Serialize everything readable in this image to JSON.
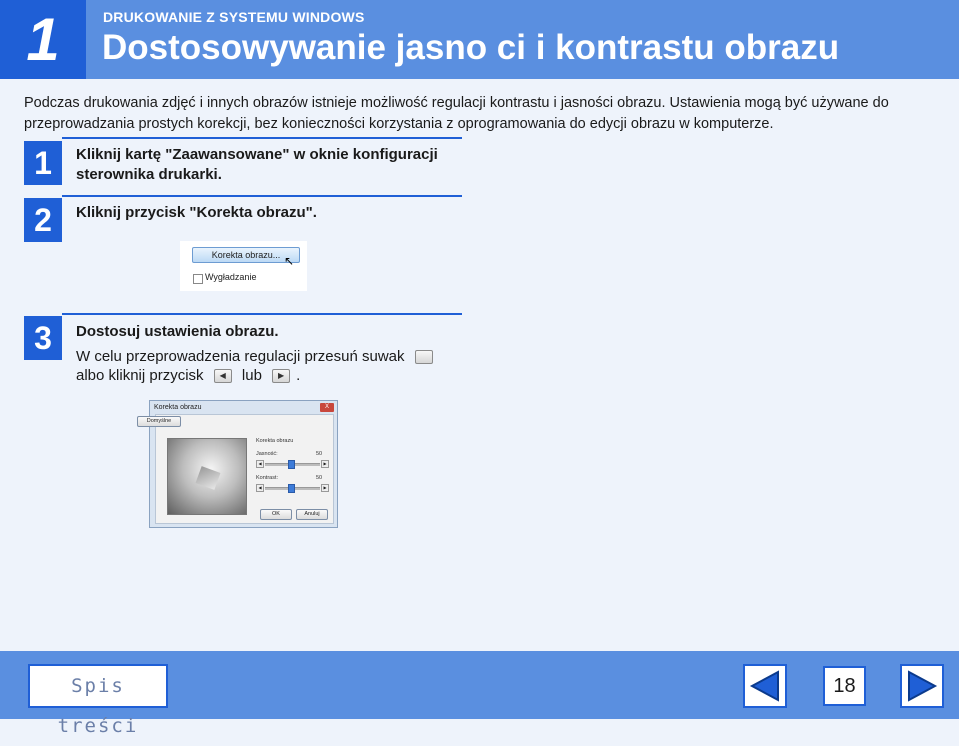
{
  "header": {
    "chapter": "1",
    "section": "DRUKOWANIE Z SYSTEMU WINDOWS",
    "title": "Dostosowywanie jasno ci i kontrastu obrazu"
  },
  "intro": "Podczas drukowania zdjęć i innych obrazów istnieje możliwość regulacji kontrastu i jasności obrazu. Ustawienia mogą być używane do przeprowadzania prostych korekcji, bez konieczności korzystania z oprogramowania do edycji obrazu w komputerze.",
  "steps": [
    {
      "num": "1",
      "text": "Kliknij kartę \"Zaawansowane\" w oknie konfiguracji sterownika drukarki."
    },
    {
      "num": "2",
      "text": "Kliknij przycisk \"Korekta obrazu\"."
    },
    {
      "num": "3",
      "text": "Dostosuj ustawienia obrazu.",
      "body_line1": "W celu przeprowadzenia regulacji przesuń suwak",
      "body_line2a": "albo kliknij przycisk",
      "body_line2b": "lub",
      "body_line2c": "."
    }
  ],
  "screenshot1": {
    "button": "Korekta obrazu...",
    "checkbox": "Wygładzanie"
  },
  "dialog": {
    "title": "Korekta obrazu",
    "default_btn": "Domyślne",
    "group": "Korekta obrazu",
    "brightness_label": "Jasność:",
    "brightness_value": "50",
    "contrast_label": "Kontrast:",
    "contrast_value": "50",
    "ok": "OK",
    "cancel": "Anuluj"
  },
  "footer": {
    "toc": "Spis treści",
    "page": "18"
  },
  "colors": {
    "accent": "#1f5fd6",
    "header_bg": "#5a8fe0"
  }
}
